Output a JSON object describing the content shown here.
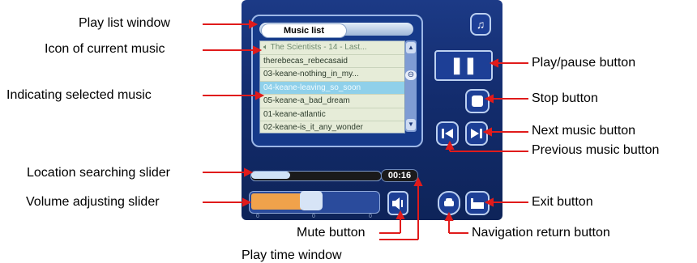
{
  "player": {
    "tab_label": "Music list",
    "playlist": [
      "The Scientists - 14 - Last...",
      "therebecas_rebecasaid",
      "03-keane-nothing_in_my...",
      "04-keane-leaving_so_soon",
      "05-keane-a_bad_dream",
      "01-keane-atlantic",
      "02-keane-is_it_any_wonder"
    ],
    "time": "00:16",
    "volume_ticks": [
      "0",
      "0",
      "0"
    ]
  },
  "annotations": {
    "playlist_window": "Play list window",
    "icon_current_music": "Icon of current music",
    "indicating_selected": "Indicating selected music",
    "location_slider": "Location searching slider",
    "volume_slider": "Volume adjusting slider",
    "mute_button": "Mute button",
    "playtime_window": "Play time window",
    "play_pause": "Play/pause button",
    "stop_button": "Stop button",
    "next_button": "Next music button",
    "previous_button": "Previous music button",
    "exit_button": "Exit button",
    "nav_return": "Navigation return button"
  }
}
